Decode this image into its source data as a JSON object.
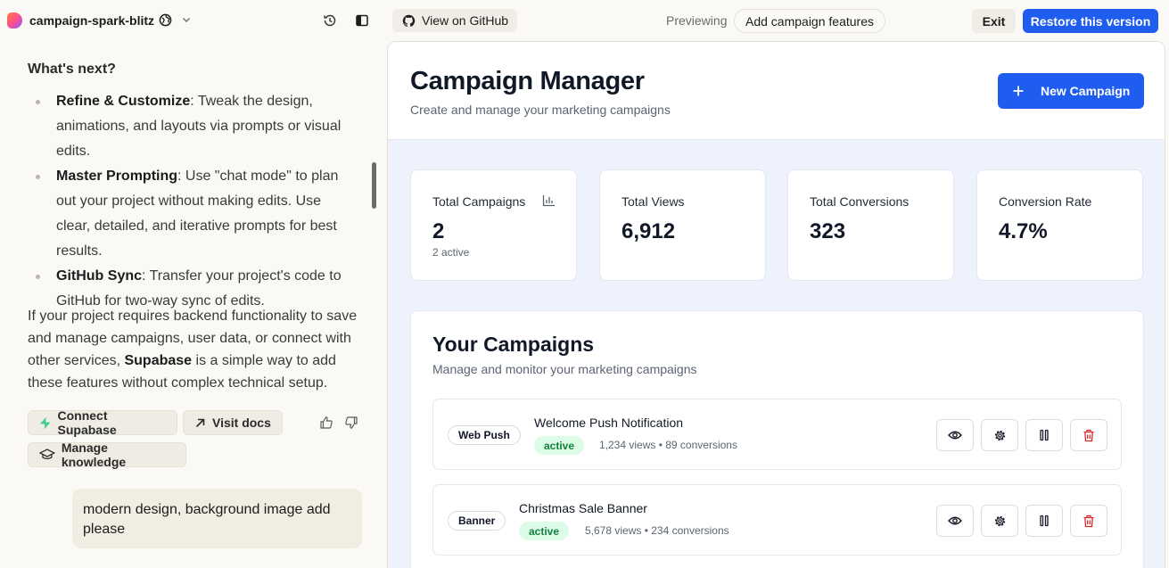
{
  "topbar": {
    "project_name": "campaign-spark-blitz",
    "github_label": "View on GitHub",
    "previewing_label": "Previewing",
    "preview_version": "Add campaign features",
    "exit_label": "Exit",
    "restore_label": "Restore this version"
  },
  "chat": {
    "heading": "What's next?",
    "bullets": [
      {
        "title": "Refine & Customize",
        "text": ": Tweak the design, animations, and layouts via prompts or visual edits."
      },
      {
        "title": "Master Prompting",
        "text": ": Use \"chat mode\" to plan out your project without making edits. Use clear, detailed, and iterative prompts for best results."
      },
      {
        "title": "GitHub Sync",
        "text": ": Transfer your project's code to GitHub for two-way sync of edits."
      }
    ],
    "para_before": "If your project requires backend functionality to save and manage campaigns, user data, or connect with other services, ",
    "para_bold": "Supabase",
    "para_after": " is a simple way to add these features without complex technical setup.",
    "chips": {
      "connect": "Connect Supabase",
      "docs": "Visit docs",
      "knowledge": "Manage knowledge"
    },
    "user_message": "modern design, background image add please"
  },
  "app": {
    "title": "Campaign Manager",
    "subtitle": "Create and manage your marketing campaigns",
    "new_button": "New Campaign",
    "stats": [
      {
        "label": "Total Campaigns",
        "value": "2",
        "note": "2 active"
      },
      {
        "label": "Total Views",
        "value": "6,912",
        "note": ""
      },
      {
        "label": "Total Conversions",
        "value": "323",
        "note": ""
      },
      {
        "label": "Conversion Rate",
        "value": "4.7%",
        "note": ""
      }
    ],
    "campaigns_title": "Your Campaigns",
    "campaigns_subtitle": "Manage and monitor your marketing campaigns",
    "campaigns": [
      {
        "type": "Web Push",
        "name": "Welcome Push Notification",
        "status": "active",
        "meta": "1,234 views • 89 conversions"
      },
      {
        "type": "Banner",
        "name": "Christmas Sale Banner",
        "status": "active",
        "meta": "5,678 views • 234 conversions"
      }
    ]
  },
  "colors": {
    "primary": "#1f5cf0",
    "active_bg": "#dcfce7",
    "active_text": "#15803d",
    "delete": "#dc2626"
  }
}
